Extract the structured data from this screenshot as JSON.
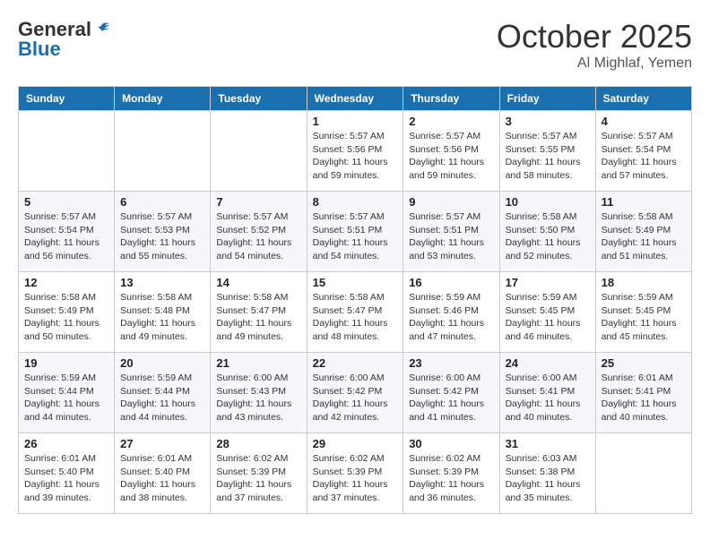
{
  "header": {
    "logo_general": "General",
    "logo_blue": "Blue",
    "month": "October 2025",
    "location": "Al Mighlaf, Yemen"
  },
  "days_of_week": [
    "Sunday",
    "Monday",
    "Tuesday",
    "Wednesday",
    "Thursday",
    "Friday",
    "Saturday"
  ],
  "weeks": [
    [
      {
        "day": "",
        "info": ""
      },
      {
        "day": "",
        "info": ""
      },
      {
        "day": "",
        "info": ""
      },
      {
        "day": "1",
        "sunrise": "Sunrise: 5:57 AM",
        "sunset": "Sunset: 5:56 PM",
        "daylight": "Daylight: 11 hours and 59 minutes."
      },
      {
        "day": "2",
        "sunrise": "Sunrise: 5:57 AM",
        "sunset": "Sunset: 5:56 PM",
        "daylight": "Daylight: 11 hours and 59 minutes."
      },
      {
        "day": "3",
        "sunrise": "Sunrise: 5:57 AM",
        "sunset": "Sunset: 5:55 PM",
        "daylight": "Daylight: 11 hours and 58 minutes."
      },
      {
        "day": "4",
        "sunrise": "Sunrise: 5:57 AM",
        "sunset": "Sunset: 5:54 PM",
        "daylight": "Daylight: 11 hours and 57 minutes."
      }
    ],
    [
      {
        "day": "5",
        "sunrise": "Sunrise: 5:57 AM",
        "sunset": "Sunset: 5:54 PM",
        "daylight": "Daylight: 11 hours and 56 minutes."
      },
      {
        "day": "6",
        "sunrise": "Sunrise: 5:57 AM",
        "sunset": "Sunset: 5:53 PM",
        "daylight": "Daylight: 11 hours and 55 minutes."
      },
      {
        "day": "7",
        "sunrise": "Sunrise: 5:57 AM",
        "sunset": "Sunset: 5:52 PM",
        "daylight": "Daylight: 11 hours and 54 minutes."
      },
      {
        "day": "8",
        "sunrise": "Sunrise: 5:57 AM",
        "sunset": "Sunset: 5:51 PM",
        "daylight": "Daylight: 11 hours and 54 minutes."
      },
      {
        "day": "9",
        "sunrise": "Sunrise: 5:57 AM",
        "sunset": "Sunset: 5:51 PM",
        "daylight": "Daylight: 11 hours and 53 minutes."
      },
      {
        "day": "10",
        "sunrise": "Sunrise: 5:58 AM",
        "sunset": "Sunset: 5:50 PM",
        "daylight": "Daylight: 11 hours and 52 minutes."
      },
      {
        "day": "11",
        "sunrise": "Sunrise: 5:58 AM",
        "sunset": "Sunset: 5:49 PM",
        "daylight": "Daylight: 11 hours and 51 minutes."
      }
    ],
    [
      {
        "day": "12",
        "sunrise": "Sunrise: 5:58 AM",
        "sunset": "Sunset: 5:49 PM",
        "daylight": "Daylight: 11 hours and 50 minutes."
      },
      {
        "day": "13",
        "sunrise": "Sunrise: 5:58 AM",
        "sunset": "Sunset: 5:48 PM",
        "daylight": "Daylight: 11 hours and 49 minutes."
      },
      {
        "day": "14",
        "sunrise": "Sunrise: 5:58 AM",
        "sunset": "Sunset: 5:47 PM",
        "daylight": "Daylight: 11 hours and 49 minutes."
      },
      {
        "day": "15",
        "sunrise": "Sunrise: 5:58 AM",
        "sunset": "Sunset: 5:47 PM",
        "daylight": "Daylight: 11 hours and 48 minutes."
      },
      {
        "day": "16",
        "sunrise": "Sunrise: 5:59 AM",
        "sunset": "Sunset: 5:46 PM",
        "daylight": "Daylight: 11 hours and 47 minutes."
      },
      {
        "day": "17",
        "sunrise": "Sunrise: 5:59 AM",
        "sunset": "Sunset: 5:45 PM",
        "daylight": "Daylight: 11 hours and 46 minutes."
      },
      {
        "day": "18",
        "sunrise": "Sunrise: 5:59 AM",
        "sunset": "Sunset: 5:45 PM",
        "daylight": "Daylight: 11 hours and 45 minutes."
      }
    ],
    [
      {
        "day": "19",
        "sunrise": "Sunrise: 5:59 AM",
        "sunset": "Sunset: 5:44 PM",
        "daylight": "Daylight: 11 hours and 44 minutes."
      },
      {
        "day": "20",
        "sunrise": "Sunrise: 5:59 AM",
        "sunset": "Sunset: 5:44 PM",
        "daylight": "Daylight: 11 hours and 44 minutes."
      },
      {
        "day": "21",
        "sunrise": "Sunrise: 6:00 AM",
        "sunset": "Sunset: 5:43 PM",
        "daylight": "Daylight: 11 hours and 43 minutes."
      },
      {
        "day": "22",
        "sunrise": "Sunrise: 6:00 AM",
        "sunset": "Sunset: 5:42 PM",
        "daylight": "Daylight: 11 hours and 42 minutes."
      },
      {
        "day": "23",
        "sunrise": "Sunrise: 6:00 AM",
        "sunset": "Sunset: 5:42 PM",
        "daylight": "Daylight: 11 hours and 41 minutes."
      },
      {
        "day": "24",
        "sunrise": "Sunrise: 6:00 AM",
        "sunset": "Sunset: 5:41 PM",
        "daylight": "Daylight: 11 hours and 40 minutes."
      },
      {
        "day": "25",
        "sunrise": "Sunrise: 6:01 AM",
        "sunset": "Sunset: 5:41 PM",
        "daylight": "Daylight: 11 hours and 40 minutes."
      }
    ],
    [
      {
        "day": "26",
        "sunrise": "Sunrise: 6:01 AM",
        "sunset": "Sunset: 5:40 PM",
        "daylight": "Daylight: 11 hours and 39 minutes."
      },
      {
        "day": "27",
        "sunrise": "Sunrise: 6:01 AM",
        "sunset": "Sunset: 5:40 PM",
        "daylight": "Daylight: 11 hours and 38 minutes."
      },
      {
        "day": "28",
        "sunrise": "Sunrise: 6:02 AM",
        "sunset": "Sunset: 5:39 PM",
        "daylight": "Daylight: 11 hours and 37 minutes."
      },
      {
        "day": "29",
        "sunrise": "Sunrise: 6:02 AM",
        "sunset": "Sunset: 5:39 PM",
        "daylight": "Daylight: 11 hours and 37 minutes."
      },
      {
        "day": "30",
        "sunrise": "Sunrise: 6:02 AM",
        "sunset": "Sunset: 5:39 PM",
        "daylight": "Daylight: 11 hours and 36 minutes."
      },
      {
        "day": "31",
        "sunrise": "Sunrise: 6:03 AM",
        "sunset": "Sunset: 5:38 PM",
        "daylight": "Daylight: 11 hours and 35 minutes."
      },
      {
        "day": "",
        "info": ""
      }
    ]
  ]
}
